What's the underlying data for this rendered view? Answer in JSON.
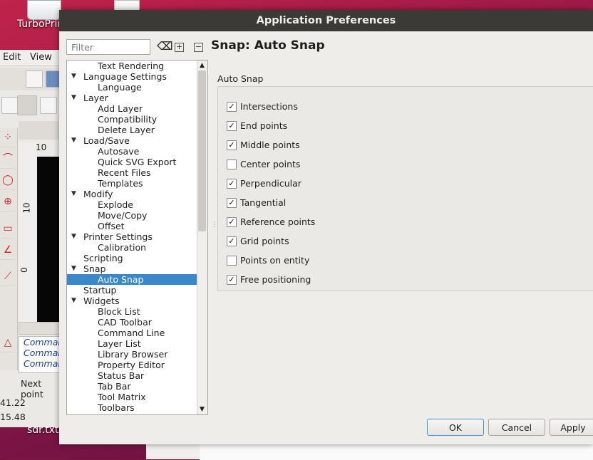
{
  "desktop": {
    "icon_label": "TurboPrint",
    "file_label": "sdr.txt"
  },
  "background_app": {
    "menu": [
      "Edit",
      "View"
    ],
    "ruler_top": "10",
    "ruler_mid": "10",
    "ruler_zero": "0",
    "command_lines": [
      "Command",
      "Command",
      "Command"
    ],
    "next_point": "Next point",
    "coord_x": "41.22",
    "coord_y": "15.48"
  },
  "dialog": {
    "title": "Application Preferences",
    "filter_placeholder": "Filter",
    "page_title": "Snap: Auto Snap",
    "tree": [
      {
        "label": "Text Rendering",
        "level": 1
      },
      {
        "label": "Language Settings",
        "level": 0
      },
      {
        "label": "Language",
        "level": 1
      },
      {
        "label": "Layer",
        "level": 0
      },
      {
        "label": "Add Layer",
        "level": 1
      },
      {
        "label": "Compatibility",
        "level": 1
      },
      {
        "label": "Delete Layer",
        "level": 1
      },
      {
        "label": "Load/Save",
        "level": 0
      },
      {
        "label": "Autosave",
        "level": 1
      },
      {
        "label": "Quick SVG Export",
        "level": 1
      },
      {
        "label": "Recent Files",
        "level": 1
      },
      {
        "label": "Templates",
        "level": 1
      },
      {
        "label": "Modify",
        "level": 0
      },
      {
        "label": "Explode",
        "level": 1
      },
      {
        "label": "Move/Copy",
        "level": 1
      },
      {
        "label": "Offset",
        "level": 1
      },
      {
        "label": "Printer Settings",
        "level": 0
      },
      {
        "label": "Calibration",
        "level": 1
      },
      {
        "label": "Scripting",
        "level": 0,
        "leaf": true
      },
      {
        "label": "Snap",
        "level": 0
      },
      {
        "label": "Auto Snap",
        "level": 1,
        "selected": true
      },
      {
        "label": "Startup",
        "level": 0,
        "leaf": true
      },
      {
        "label": "Widgets",
        "level": 0
      },
      {
        "label": "Block List",
        "level": 1
      },
      {
        "label": "CAD Toolbar",
        "level": 1
      },
      {
        "label": "Command Line",
        "level": 1
      },
      {
        "label": "Layer List",
        "level": 1
      },
      {
        "label": "Library Browser",
        "level": 1
      },
      {
        "label": "Property Editor",
        "level": 1
      },
      {
        "label": "Status Bar",
        "level": 1
      },
      {
        "label": "Tab Bar",
        "level": 1
      },
      {
        "label": "Tool Matrix",
        "level": 1
      },
      {
        "label": "Toolbars",
        "level": 1
      }
    ],
    "group_title": "Auto Snap",
    "options": [
      {
        "label": "Intersections",
        "checked": true
      },
      {
        "label": "End points",
        "checked": true
      },
      {
        "label": "Middle points",
        "checked": true
      },
      {
        "label": "Center points",
        "checked": false
      },
      {
        "label": "Perpendicular",
        "checked": true
      },
      {
        "label": "Tangential",
        "checked": true
      },
      {
        "label": "Reference points",
        "checked": true
      },
      {
        "label": "Grid points",
        "checked": true
      },
      {
        "label": "Points on entity",
        "checked": false
      },
      {
        "label": "Free positioning",
        "checked": true
      }
    ],
    "buttons": {
      "ok": "OK",
      "cancel": "Cancel",
      "apply": "Apply"
    },
    "colors": {
      "selection": "#3a87c9",
      "titlebar": "#3b3a37"
    }
  }
}
